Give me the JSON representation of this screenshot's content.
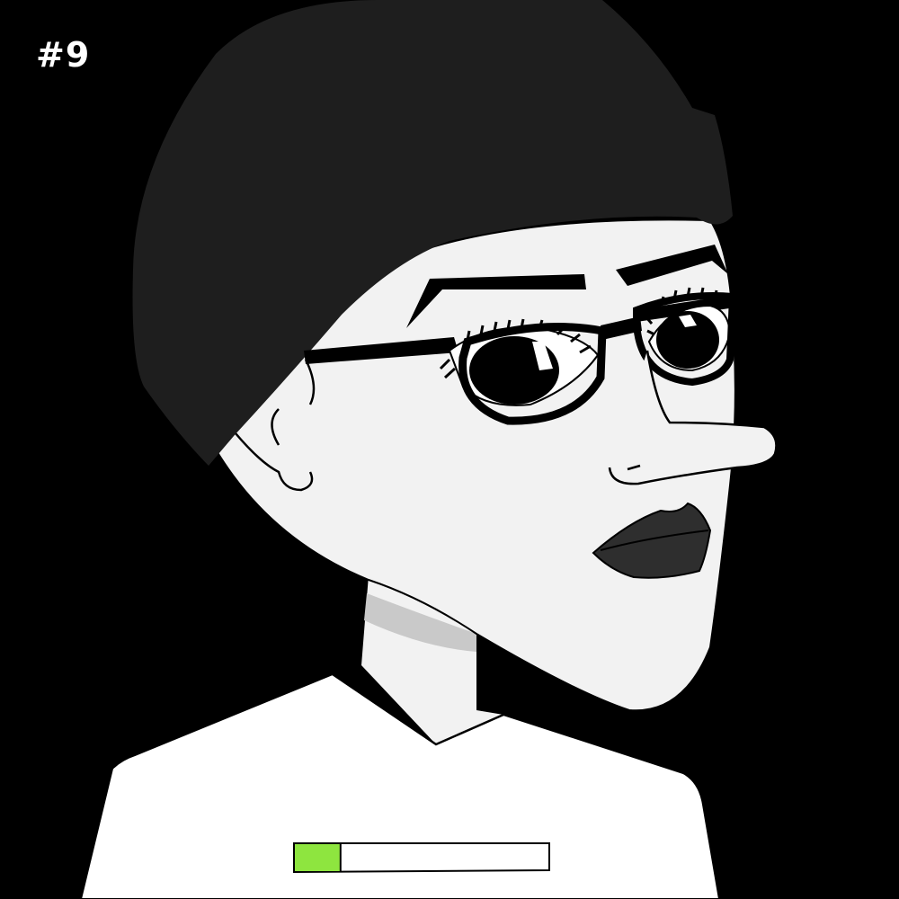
{
  "token": {
    "label": "#9"
  },
  "progress": {
    "fraction": 0.18,
    "fill_color": "#8ee53f",
    "track_color": "#ffffff"
  },
  "palette": {
    "background": "#000000",
    "skin": "#f2f2f2",
    "beanie": "#1e1e1e",
    "lips": "#2e2e2e",
    "shirt": "#ffffff",
    "neck_shadow": "#c9c9c9"
  }
}
